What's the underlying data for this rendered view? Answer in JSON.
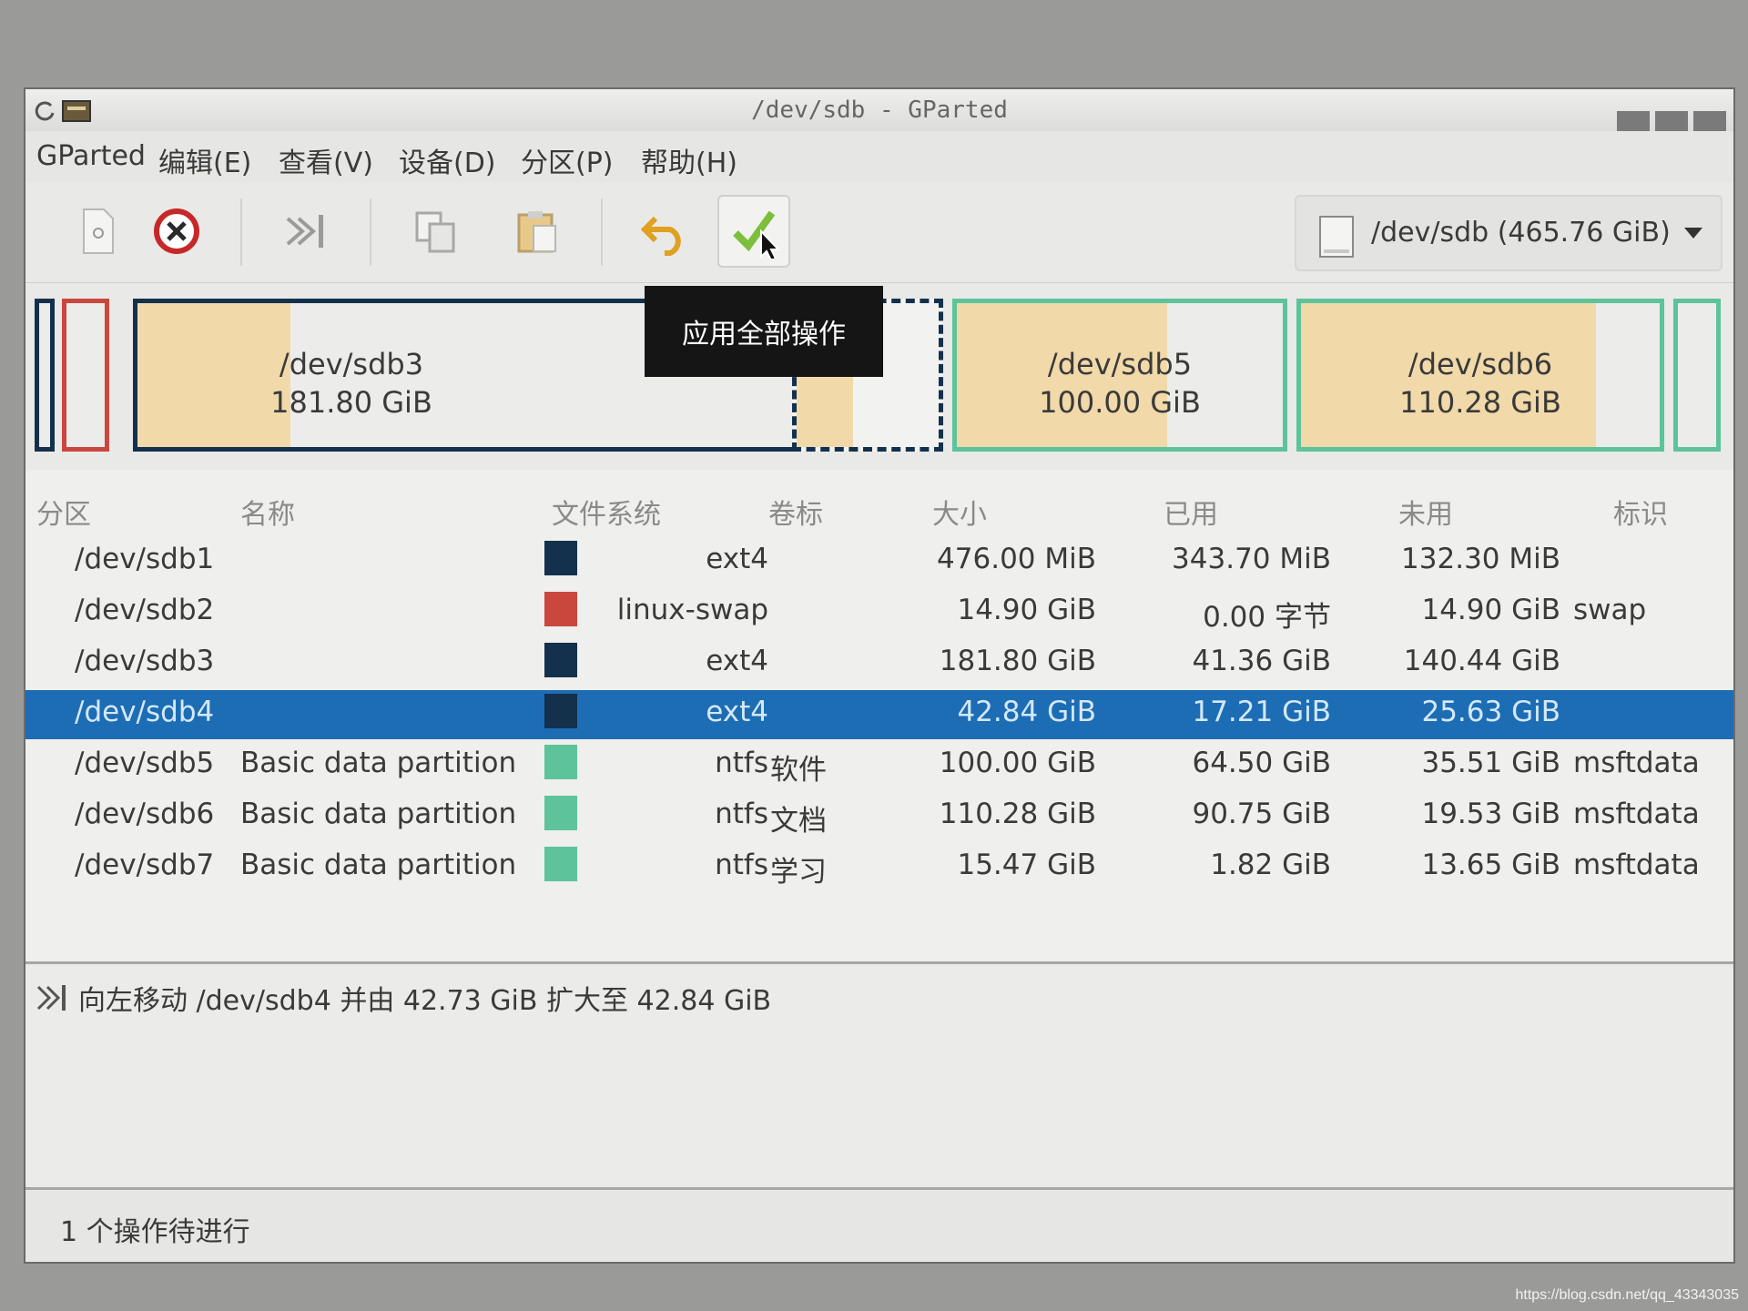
{
  "window": {
    "title": "/dev/sdb - GParted"
  },
  "menu": [
    "GParted",
    "编辑(E)",
    "查看(V)",
    "设备(D)",
    "分区(P)",
    "帮助(H)"
  ],
  "toolbar": {
    "buttons": [
      "new-icon",
      "delete-icon",
      "resize-move-icon",
      "copy-icon",
      "paste-icon",
      "undo-icon",
      "apply-icon"
    ],
    "device": "/dev/sdb (465.76 GiB)",
    "tooltip": "应用全部操作"
  },
  "map": {
    "sdb3": {
      "name": "/dev/sdb3",
      "size": "181.80 GiB",
      "used_fraction": 0.23
    },
    "sdb5": {
      "name": "/dev/sdb5",
      "size": "100.00 GiB",
      "used_fraction": 0.645
    },
    "sdb6": {
      "name": "/dev/sdb6",
      "size": "110.28 GiB",
      "used_fraction": 0.823
    },
    "sdb4": {
      "used_fraction": 0.4
    }
  },
  "colors": {
    "ext4": "#13314c",
    "linux_swap": "#c9473d",
    "ntfs": "#5dc39a",
    "selection": "#1d6db5",
    "used": "#f1d9a9"
  },
  "table": {
    "headers": [
      "分区",
      "名称",
      "文件系统",
      "卷标",
      "大小",
      "已用",
      "未用",
      "标识"
    ],
    "rows": [
      {
        "partition": "/dev/sdb1",
        "name": "",
        "fs": "ext4",
        "label": "",
        "size": "476.00 MiB",
        "used": "343.70 MiB",
        "unused": "132.30 MiB",
        "flags": ""
      },
      {
        "partition": "/dev/sdb2",
        "name": "",
        "fs": "linux-swap",
        "label": "",
        "size": "14.90 GiB",
        "used": "0.00 字节",
        "unused": "14.90 GiB",
        "flags": "swap"
      },
      {
        "partition": "/dev/sdb3",
        "name": "",
        "fs": "ext4",
        "label": "",
        "size": "181.80 GiB",
        "used": "41.36 GiB",
        "unused": "140.44 GiB",
        "flags": ""
      },
      {
        "partition": "/dev/sdb4",
        "name": "",
        "fs": "ext4",
        "label": "",
        "size": "42.84 GiB",
        "used": "17.21 GiB",
        "unused": "25.63 GiB",
        "flags": ""
      },
      {
        "partition": "/dev/sdb5",
        "name": "Basic data partition",
        "fs": "ntfs",
        "label": "软件",
        "size": "100.00 GiB",
        "used": "64.50 GiB",
        "unused": "35.51 GiB",
        "flags": "msftdata"
      },
      {
        "partition": "/dev/sdb6",
        "name": "Basic data partition",
        "fs": "ntfs",
        "label": "文档",
        "size": "110.28 GiB",
        "used": "90.75 GiB",
        "unused": "19.53 GiB",
        "flags": "msftdata"
      },
      {
        "partition": "/dev/sdb7",
        "name": "Basic data partition",
        "fs": "ntfs",
        "label": "学习",
        "size": "15.47 GiB",
        "used": "1.82 GiB",
        "unused": "13.65 GiB",
        "flags": "msftdata"
      }
    ]
  },
  "operations": [
    "向左移动 /dev/sdb4 并由 42.73 GiB 扩大至 42.84 GiB"
  ],
  "status": "1 个操作待进行",
  "watermark": "https://blog.csdn.net/qq_43343035"
}
